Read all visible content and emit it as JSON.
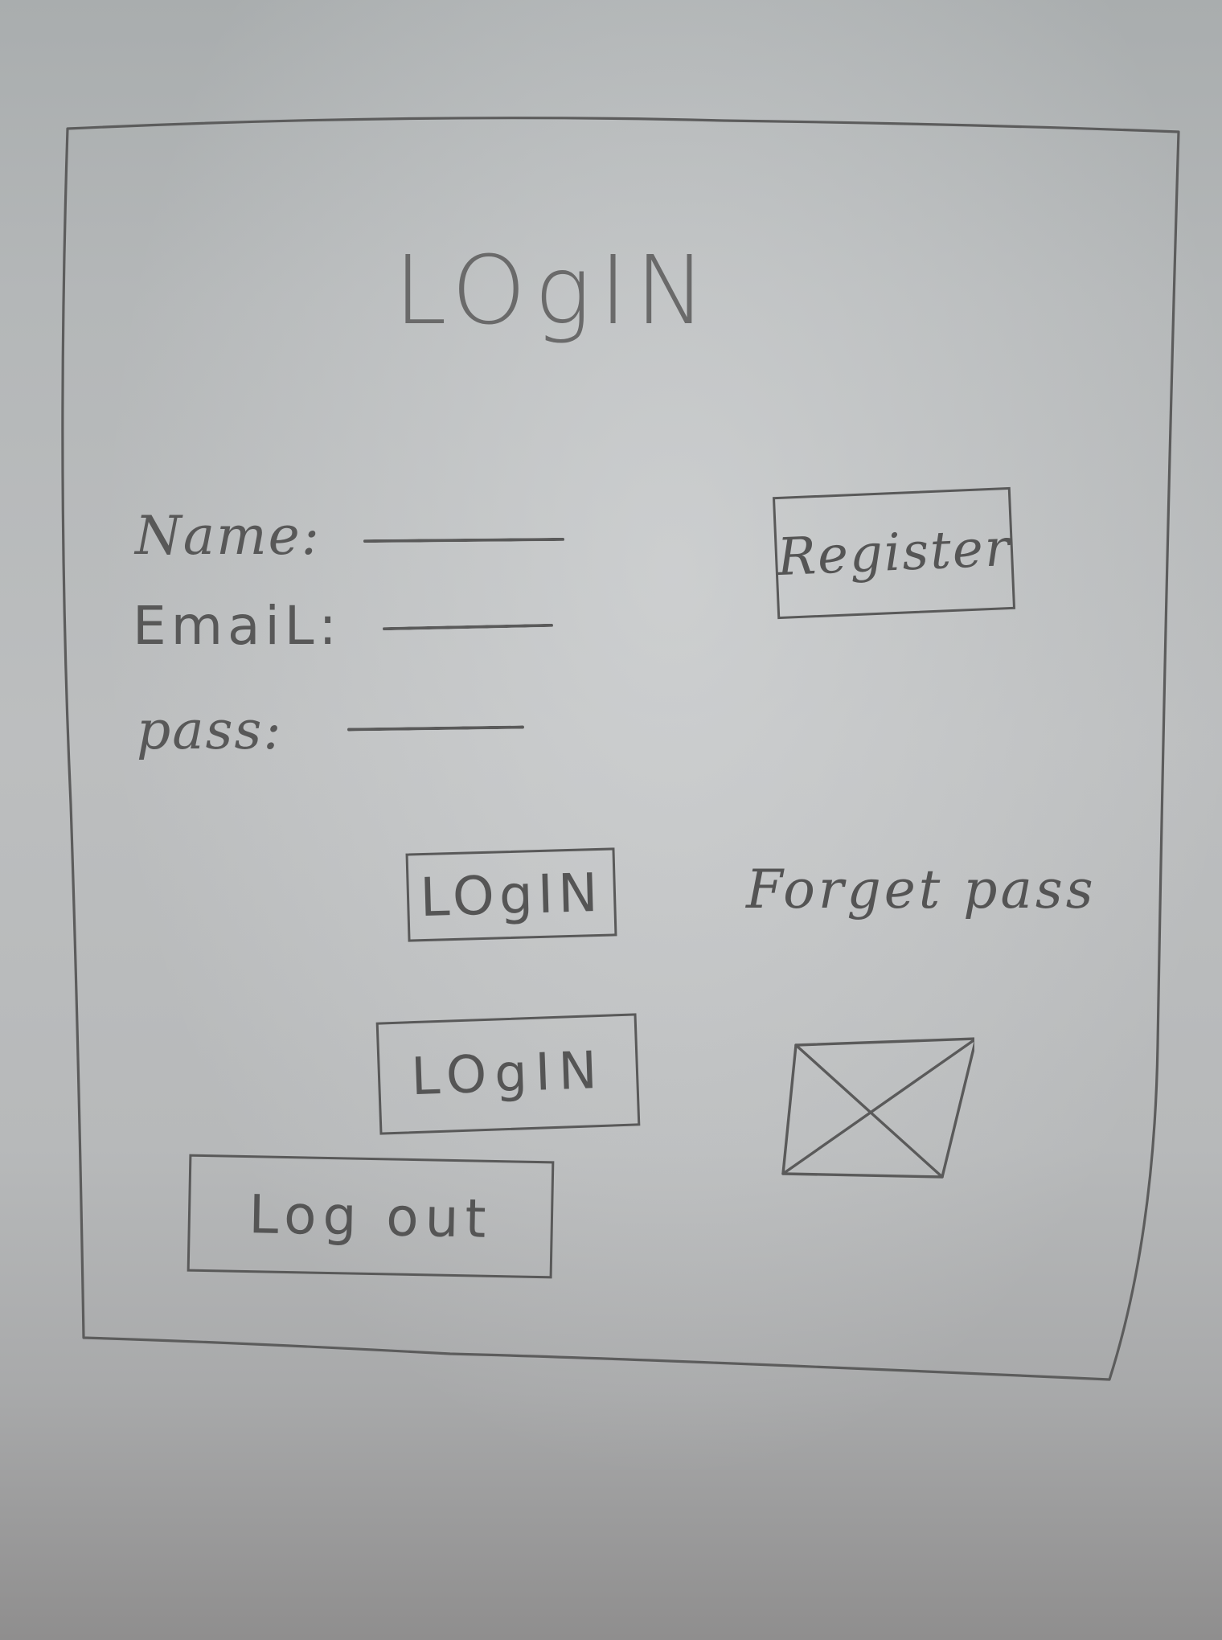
{
  "header": {
    "title": "LOgIN"
  },
  "form": {
    "name_label": "Name:",
    "email_label": "EmaiL:",
    "pass_label": "pass:",
    "name_value": "",
    "email_value": "",
    "pass_value": ""
  },
  "actions": {
    "register_label": "Register",
    "login_primary_label": "LOgIN",
    "forget_pass_label": "Forget pass",
    "login_secondary_label": "LOgIN",
    "logout_label": "Log out"
  },
  "image_placeholder": {
    "icon": "image-placeholder-icon"
  },
  "colors": {
    "pencil": "#595959",
    "paper": "#b9bbbc"
  }
}
